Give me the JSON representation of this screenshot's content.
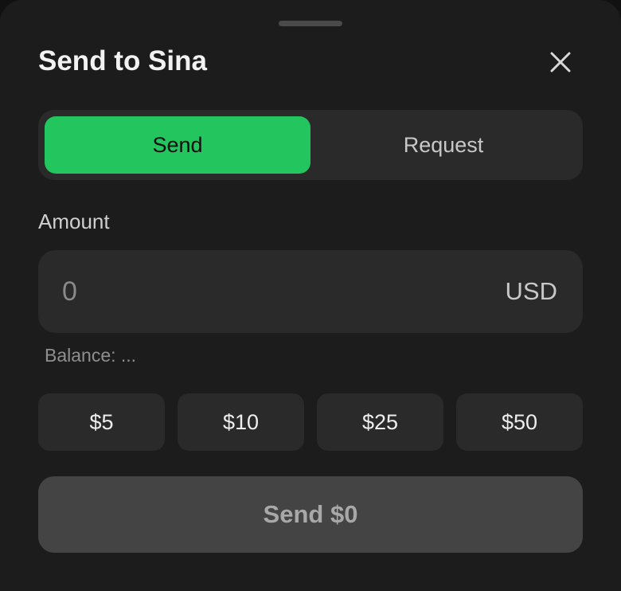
{
  "sheet": {
    "title": "Send to Sina",
    "close_icon": "close-icon"
  },
  "mode_toggle": {
    "send_label": "Send",
    "request_label": "Request",
    "selected": "Send"
  },
  "amount": {
    "label": "Amount",
    "placeholder": "0",
    "value": "",
    "currency": "USD",
    "balance_text": "Balance: ..."
  },
  "presets": [
    "$5",
    "$10",
    "$25",
    "$50"
  ],
  "submit": {
    "label": "Send $0",
    "enabled": false
  },
  "colors": {
    "accent": "#22c55e",
    "background": "#1c1c1c",
    "surface": "#2a2a2a",
    "disabled_button": "#444444"
  }
}
